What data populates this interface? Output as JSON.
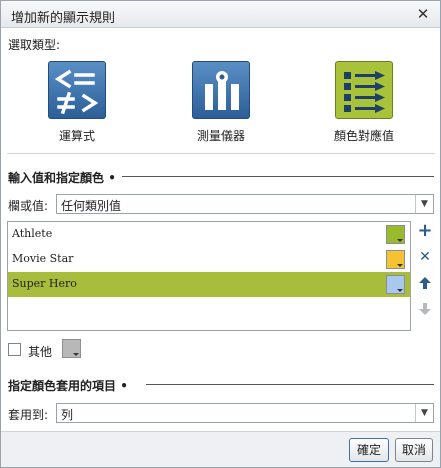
{
  "dialog": {
    "title": "增加新的顯示規則",
    "close_glyph": "✕"
  },
  "type_section": {
    "label": "選取類型:",
    "options": [
      {
        "label": "運算式",
        "icon": "expression-icon",
        "selected": false
      },
      {
        "label": "測量儀器",
        "icon": "gauge-icon",
        "selected": false
      },
      {
        "label": "顏色對應值",
        "icon": "color-mapped-values-icon",
        "selected": true
      }
    ]
  },
  "values_section": {
    "title": "輸入值和指定顏色",
    "column_label": "欄或值:",
    "column_value": "任何類別值",
    "items": [
      {
        "label": "Athlete",
        "color": "#9aba2e",
        "selected": false
      },
      {
        "label": "Movie Star",
        "color": "#f5c232",
        "selected": false
      },
      {
        "label": "Super Hero",
        "color": "#a9c8ee",
        "selected": true
      }
    ],
    "other_label": "其他",
    "other_checked": false,
    "other_color": "#b8b8b8"
  },
  "apply_section": {
    "title": "指定顏色套用的項目",
    "apply_label": "套用到:",
    "apply_value": "列"
  },
  "buttons": {
    "ok": "確定",
    "cancel": "取消"
  },
  "colors": {
    "selection_bg": "#a8bd3c",
    "icon_blue": "#2c5f98",
    "icon_green": "#a8c23a",
    "accent": "#2d5b8a"
  }
}
